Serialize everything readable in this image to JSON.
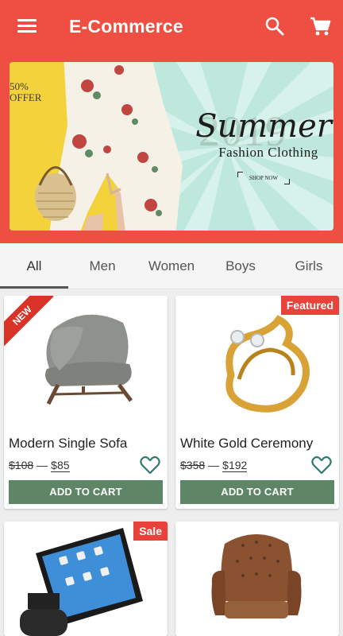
{
  "app": {
    "title": "E-Commerce"
  },
  "icons": {
    "menu": "menu-icon",
    "search": "search-icon",
    "cart": "cart-icon",
    "favorite": "heart-outline-icon"
  },
  "banner": {
    "promo": "50% OFFER",
    "year": "2019",
    "headline": "Summer",
    "subtitle": "Fashion Clothing",
    "cta": "SHOP NOW"
  },
  "tabs": [
    {
      "label": "All",
      "active": true
    },
    {
      "label": "Men",
      "active": false
    },
    {
      "label": "Women",
      "active": false
    },
    {
      "label": "Boys",
      "active": false
    },
    {
      "label": "Girls",
      "active": false
    }
  ],
  "products": [
    {
      "name": "Modern Single Sofa",
      "old_price": "$108",
      "price": "$85",
      "badge": "NEW",
      "button": "ADD TO CART"
    },
    {
      "name": "White Gold Ceremony",
      "old_price": "$358",
      "price": "$192",
      "badge": "Featured",
      "button": "ADD TO CART"
    },
    {
      "name": "",
      "old_price": "",
      "price": "",
      "badge": "Sale",
      "button": ""
    },
    {
      "name": "",
      "old_price": "",
      "price": "",
      "badge": "",
      "button": ""
    }
  ],
  "colors": {
    "primary": "#ef4f43",
    "button": "#5e8565",
    "heart": "#2f7a6c",
    "badge": "#e8423a"
  }
}
